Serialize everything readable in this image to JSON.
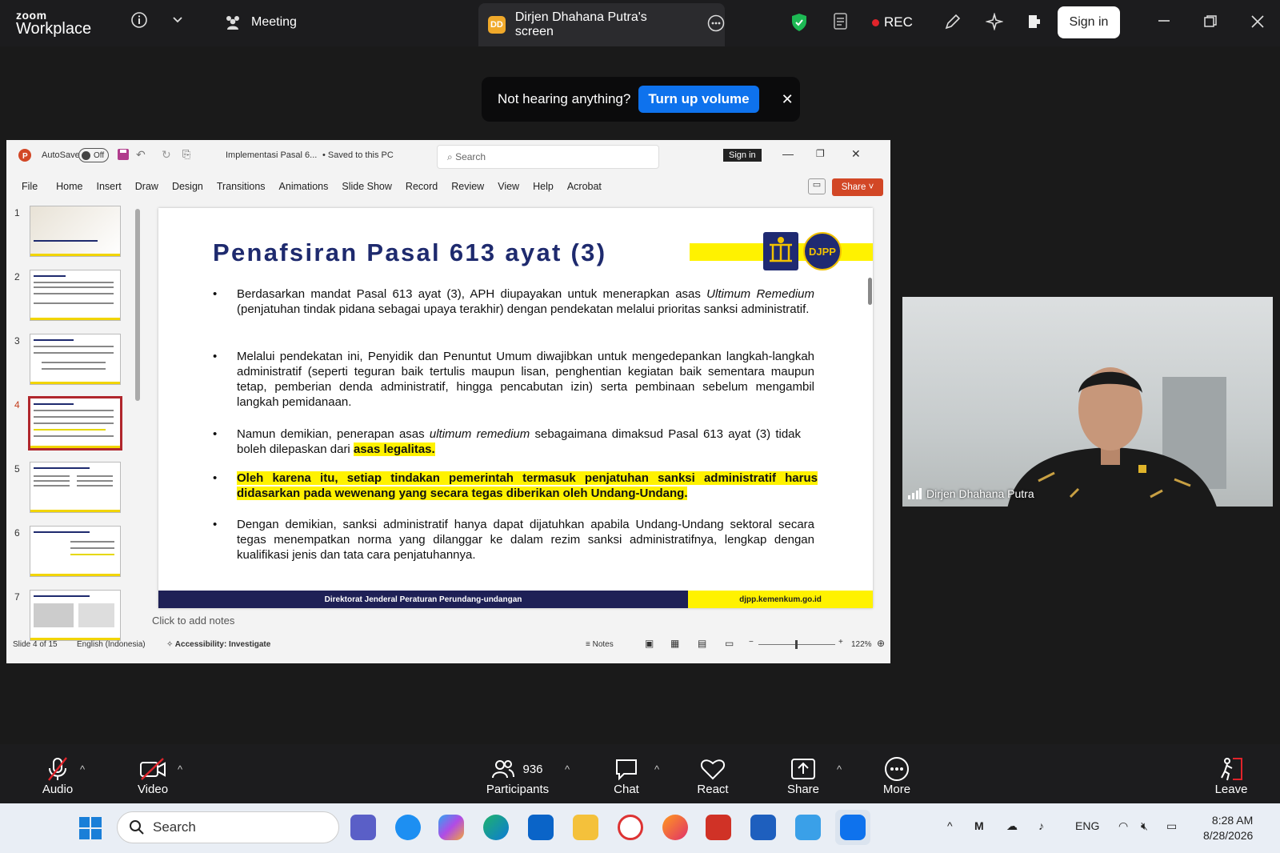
{
  "zoom": {
    "brand_small": "zoom",
    "brand_large": "Workplace",
    "meeting_label": "Meeting",
    "share_initials": "DD",
    "share_tab_label": "Dirjen Dhahana Putra's screen",
    "rec_label": "REC",
    "sign_in_label": "Sign in"
  },
  "banner": {
    "text": "Not hearing anything?",
    "button": "Turn up volume"
  },
  "ppt": {
    "autosave_label": "AutoSave",
    "autosave_state": "Off",
    "file_name": "Implementasi Pasal 6...",
    "saved_status": "• Saved to this PC",
    "search_placeholder": "Search",
    "sign_in_label": "Sign in",
    "ribbon_tabs": [
      "File",
      "Home",
      "Insert",
      "Draw",
      "Design",
      "Transitions",
      "Animations",
      "Slide Show",
      "Record",
      "Review",
      "View",
      "Help",
      "Acrobat"
    ],
    "share_label": "Share",
    "thumbnails": [
      "1",
      "2",
      "3",
      "4",
      "5",
      "6",
      "7"
    ],
    "active_slide": 4,
    "notes_placeholder": "Click to add notes",
    "status": {
      "slide_info": "Slide 4 of 15",
      "language": "English (Indonesia)",
      "accessibility": "Accessibility: Investigate",
      "notes_label": "Notes",
      "zoom_level": "122%"
    }
  },
  "slide": {
    "title": "Penafsiran Pasal 613 ayat (3)",
    "logo_text": "DJPP",
    "bullets": [
      {
        "pre": "Berdasarkan mandat Pasal 613 ayat (3), APH diupayakan untuk menerapkan asas ",
        "em": "Ultimum Remedium",
        "post": " (penjatuhan tindak pidana sebagai upaya terakhir) dengan pendekatan melalui prioritas sanksi administratif."
      },
      {
        "pre": "Melalui pendekatan ini, Penyidik dan Penuntut Umum diwajibkan untuk mengedepankan langkah-langkah administratif (seperti teguran baik tertulis maupun lisan, penghentian kegiatan baik sementara maupun tetap, pemberian denda administratif, hingga pencabutan izin) serta pembinaan sebelum mengambil langkah pemidanaan.",
        "em": "",
        "post": ""
      },
      {
        "pre": "Namun demikian, penerapan asas ",
        "em": "ultimum remedium",
        "post": " sebagaimana dimaksud Pasal 613 ayat (3) tidak boleh dilepaskan dari ",
        "hl": "asas legalitas."
      },
      {
        "highlight": "Oleh karena itu, setiap tindakan pemerintah termasuk penjatuhan sanksi administratif harus didasarkan pada wewenang yang secara tegas diberikan oleh Undang-Undang."
      },
      {
        "pre": "Dengan demikian, sanksi administratif hanya dapat dijatuhkan apabila Undang-Undang sektoral secara tegas menempatkan norma yang dilanggar ke dalam rezim sanksi administratifnya, lengkap dengan kualifikasi jenis dan tata cara penjatuhannya.",
        "em": "",
        "post": ""
      }
    ],
    "footer_left": "Direktorat Jenderal Peraturan Perundang-undangan",
    "footer_right": "djpp.kemenkum.go.id"
  },
  "video": {
    "participant_name": "Dirjen Dhahana Putra"
  },
  "controls": {
    "audio": "Audio",
    "video": "Video",
    "participants": "Participants",
    "participants_count": "936",
    "chat": "Chat",
    "react": "React",
    "share": "Share",
    "more": "More",
    "leave": "Leave"
  },
  "taskbar": {
    "search_placeholder": "Search",
    "language": "ENG",
    "time": "8:28 AM",
    "date": "8/28/2026"
  },
  "colors": {
    "zoom_blue": "#0e72ed",
    "rec_red": "#e0242b",
    "slide_title": "#1e2a6e",
    "highlight": "#fff200",
    "ppt_share": "#d24726"
  }
}
